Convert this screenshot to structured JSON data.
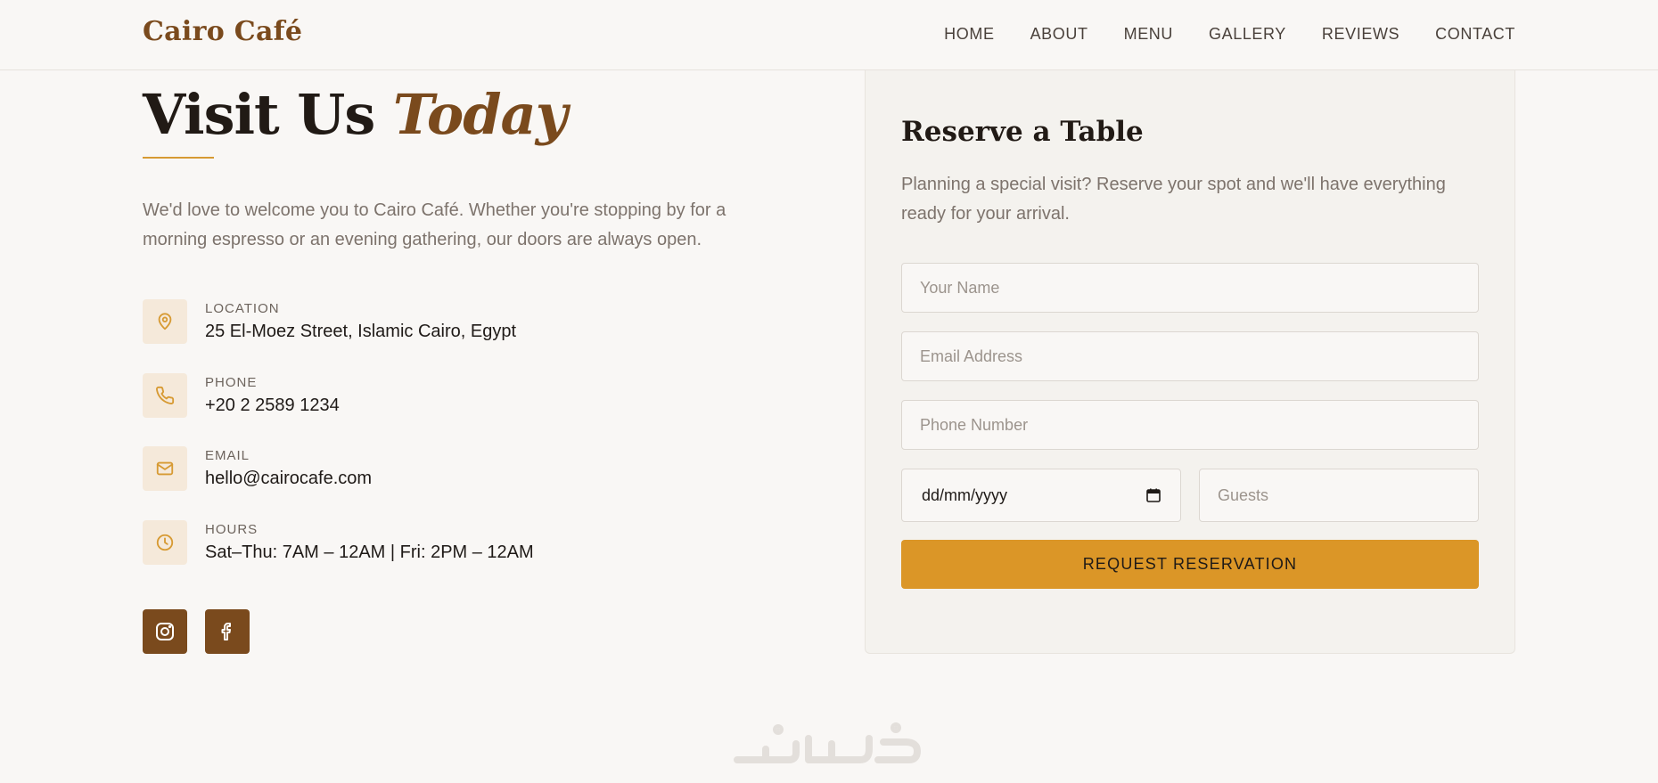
{
  "header": {
    "logo": "Cairo Café",
    "nav": [
      "HOME",
      "ABOUT",
      "MENU",
      "GALLERY",
      "REVIEWS",
      "CONTACT"
    ]
  },
  "visit": {
    "title_main": "Visit Us",
    "title_accent": "Today",
    "intro": "We'd love to welcome you to Cairo Café. Whether you're stopping by for a morning espresso or an evening gathering, our doors are always open.",
    "items": [
      {
        "label": "LOCATION",
        "value": "25 El-Moez Street, Islamic Cairo, Egypt",
        "icon": "location-pin-icon"
      },
      {
        "label": "PHONE",
        "value": "+20 2 2589 1234",
        "icon": "phone-icon"
      },
      {
        "label": "EMAIL",
        "value": "hello@cairocafe.com",
        "icon": "envelope-icon"
      },
      {
        "label": "HOURS",
        "value": "Sat–Thu: 7AM – 12AM | Fri: 2PM – 12AM",
        "icon": "clock-icon"
      }
    ],
    "social": [
      "instagram-icon",
      "facebook-icon"
    ]
  },
  "reservation": {
    "title": "Reserve a Table",
    "description": "Planning a special visit? Reserve your spot and we'll have everything ready for your arrival.",
    "name_placeholder": "Your Name",
    "email_placeholder": "Email Address",
    "phone_placeholder": "Phone Number",
    "date_value": "dd/mm/yyyy",
    "guests_placeholder": "Guests",
    "submit_label": "REQUEST RESERVATION"
  },
  "colors": {
    "brand": "#7a4a1d",
    "accent": "#db9627",
    "background": "#f9f7f5"
  }
}
